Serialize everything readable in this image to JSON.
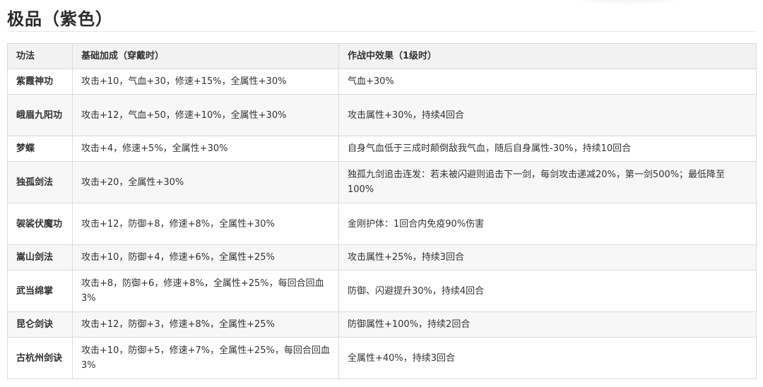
{
  "heading": "极品（紫色）",
  "table": {
    "columns": [
      "功法",
      "基础加成（穿戴时）",
      "作战中效果（1级时）"
    ],
    "rows": [
      {
        "name": "紫霞神功",
        "base": "攻击+10，气血+30，修速+15%，全属性+30%",
        "effect": "气血+30%"
      },
      {
        "name": "峨眉九阳功",
        "base": "攻击+12，气血+50，修速+10%，全属性+30%",
        "effect": "攻击属性+30%，持续4回合"
      },
      {
        "name": "梦蝶",
        "base": "攻击+4，修速+5%，全属性+30%",
        "effect": "自身气血低于三成时颠倒敌我气血，随后自身属性-30%，持续10回合"
      },
      {
        "name": "独孤剑法",
        "base": "攻击+20，全属性+30%",
        "effect": "独孤九剑追击连发：若未被闪避则追击下一剑，每剑攻击递减20%，第一剑500%；最低降至100%"
      },
      {
        "name": "袈裟伏魔功",
        "base": "攻击+12，防御+8，修速+8%，全属性+30%",
        "effect": "金刚护体：1回合内免疫90%伤害"
      },
      {
        "name": "嵩山剑法",
        "base": "攻击+10，防御+4，修速+6%，全属性+25%",
        "effect": "攻击属性+25%，持续3回合"
      },
      {
        "name": "武当绵掌",
        "base": "攻击+8，防御+6，修速+8%，全属性+25%，每回合回血3%",
        "effect": "防御、闪避提升30%，持续4回合"
      },
      {
        "name": "昆仑剑诀",
        "base": "攻击+12，防御+3，修速+8%，全属性+25%",
        "effect": "防御属性+100%，持续2回合"
      },
      {
        "name": "古杭州剑诀",
        "base": "攻击+10，防御+5，修速+7%，全属性+25%，每回合回血3%",
        "effect": "全属性+40%，持续3回合"
      }
    ]
  }
}
